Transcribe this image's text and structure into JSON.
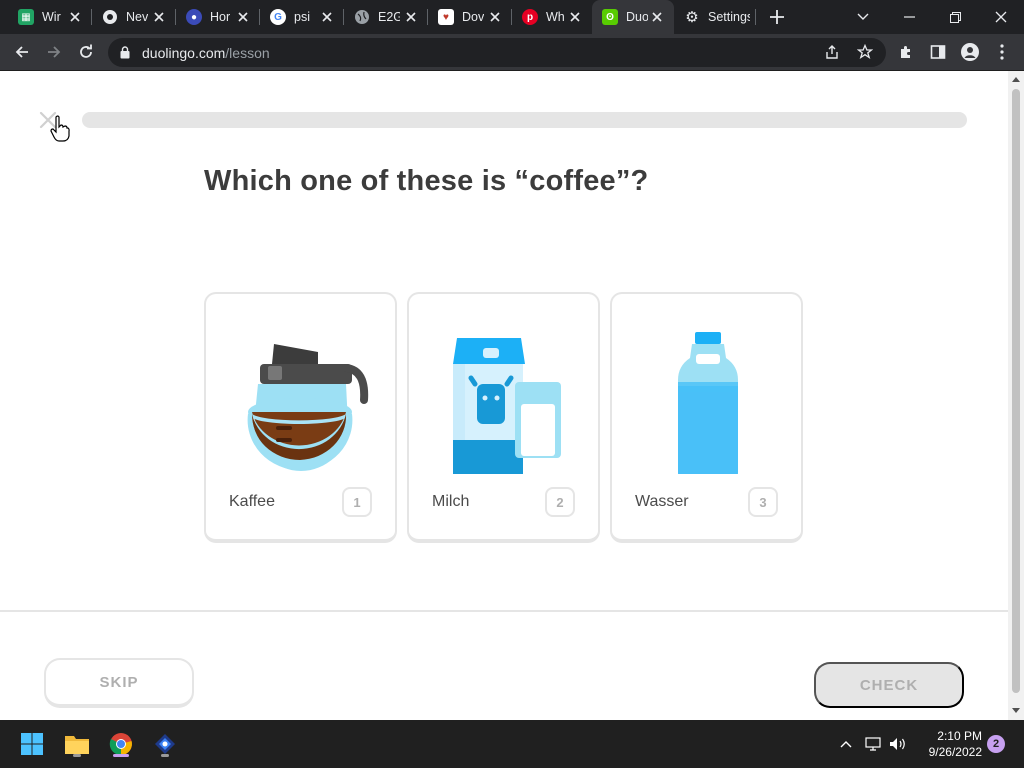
{
  "browser": {
    "tabs": [
      {
        "title": "Wir",
        "favicon": "sheets-icon",
        "color": "#21a464"
      },
      {
        "title": "Nev",
        "favicon": "chrome-icon",
        "color": "#9aa0a6"
      },
      {
        "title": "Hor",
        "favicon": "site-icon",
        "color": "#3b4bb8"
      },
      {
        "title": "psi",
        "favicon": "google-icon",
        "color": "#4285f4"
      },
      {
        "title": "E2G",
        "favicon": "globe-icon",
        "color": "#9aa0a6"
      },
      {
        "title": "Dov",
        "favicon": "site-icon",
        "color": "#c0392b"
      },
      {
        "title": "Wh",
        "favicon": "pinterest-icon",
        "color": "#e60023"
      },
      {
        "title": "Duo",
        "favicon": "duolingo-icon",
        "color": "#58cc02"
      },
      {
        "title": "Settings",
        "favicon": "gear-icon",
        "color": "#e8eaed"
      }
    ],
    "active_tab": 7,
    "url_domain": "duolingo.com",
    "url_path": "/lesson"
  },
  "lesson": {
    "progress": 0,
    "question": "Which one of these is “coffee”?",
    "choices": [
      {
        "word": "Kaffee",
        "number": "1",
        "image": "coffee-pot"
      },
      {
        "word": "Milch",
        "number": "2",
        "image": "milk-carton"
      },
      {
        "word": "Wasser",
        "number": "3",
        "image": "water-bottle"
      }
    ],
    "skip_label": "SKIP",
    "check_label": "CHECK"
  },
  "taskbar": {
    "time": "2:10 PM",
    "date": "9/26/2022",
    "notification_count": "2"
  },
  "colors": {
    "progress_track": "#e5e5e5",
    "progress_fill": "#58cc02",
    "question_text": "#3c3c3c",
    "card_border": "#e5e5e5"
  }
}
